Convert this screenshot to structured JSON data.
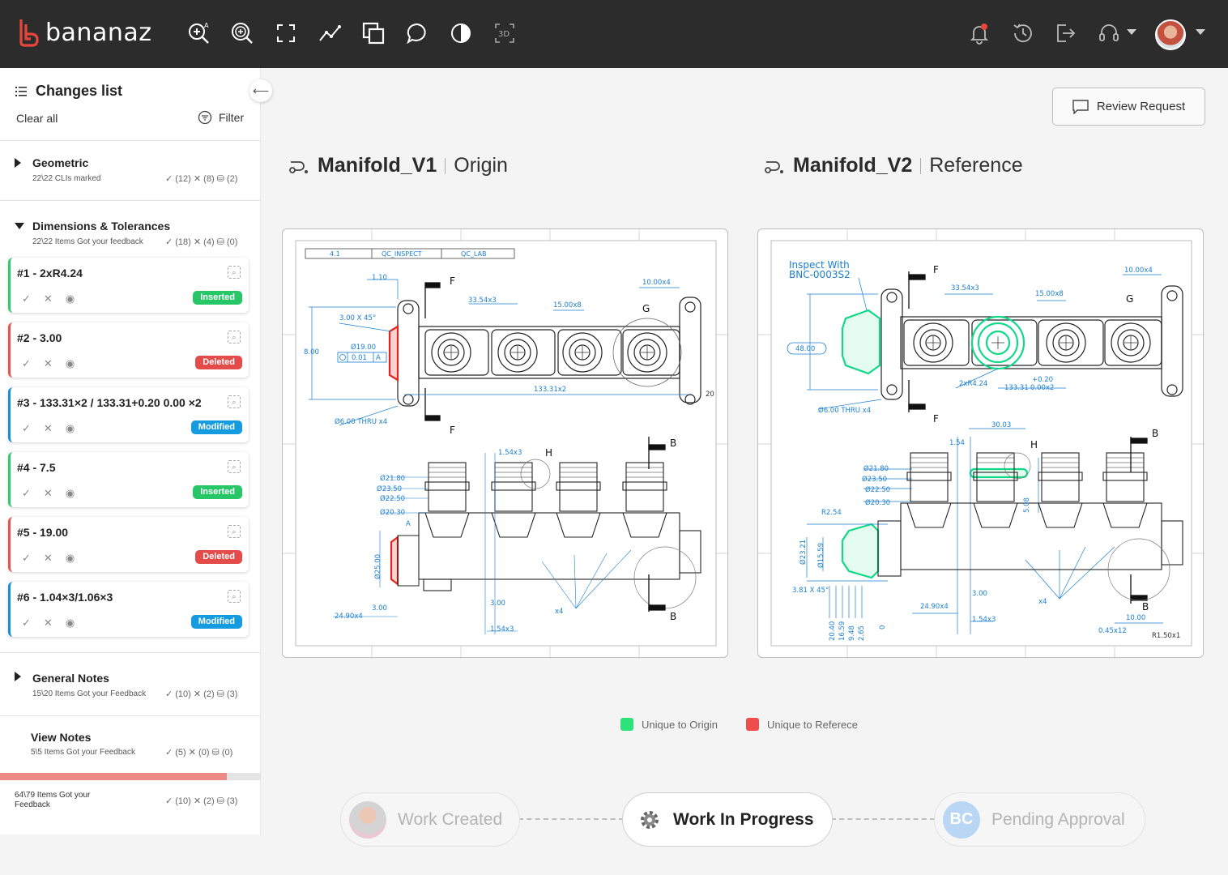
{
  "app": {
    "logo_text": "bananaz"
  },
  "toolbar": {
    "tools": [
      "zoom-text-icon",
      "zoom-in-icon",
      "fit-screen-icon",
      "line-graph-icon",
      "overlay-icon",
      "comment-icon",
      "contrast-icon",
      "3d-view-icon"
    ],
    "right": [
      "bell-icon",
      "history-icon",
      "logout-icon",
      "support-headset-icon"
    ]
  },
  "sidebar": {
    "title": "Changes list",
    "clear_all": "Clear all",
    "filter": "Filter",
    "groups": [
      {
        "title": "Geometric",
        "sub": "22\\22 CLIs marked",
        "stats": "✓ (12)  ✕ (8)  ⛁ (2)"
      },
      {
        "title": "Dimensions & Tolerances",
        "sub": "22\\22 Items Got your feedback",
        "stats": "✓ (18)  ✕ (4)  ⛁ (0)"
      },
      {
        "title": "General Notes",
        "sub": "15\\20 Items Got your Feedback",
        "stats": "✓ (10)  ✕ (2)  ⛁ (3)"
      },
      {
        "title": "View Notes",
        "sub": "5\\5 Items Got your Feedback",
        "stats": "✓ (5)  ✕ (0)  ⛁ (0)"
      }
    ],
    "cards": [
      {
        "title": "#1 - 2xR4.24",
        "status": "Inserted"
      },
      {
        "title": "#2 - 3.00",
        "status": "Deleted"
      },
      {
        "title": "#3 - 133.31×2 / 133.31+0.20 0.00 ×2",
        "status": "Modified"
      },
      {
        "title": "#4 - 7.5",
        "status": "Inserted"
      },
      {
        "title": "#5 - 19.00",
        "status": "Deleted"
      },
      {
        "title": "#6 - 1.04×3/1.06×3",
        "status": "Modified"
      }
    ],
    "card_actions": {
      "accept": "✓",
      "reject": "✕",
      "view": "◉"
    },
    "footer": {
      "text": "64\\79 Items Got your Feedback",
      "stats": "✓ (10)  ✕ (2)  ⛁ (3)",
      "progress": 0.87
    }
  },
  "main": {
    "review_button": "Review Request",
    "left": {
      "name": "Manifold_V1",
      "role": "Origin"
    },
    "right": {
      "name": "Manifold_V2",
      "role": "Reference"
    },
    "drawing_left": {
      "header_cells": [
        "4.1",
        "QC_INSPECT",
        "QC_LAB"
      ],
      "labels": [
        "1.10",
        "F",
        "33.54x3",
        "15.00x8",
        "10.00x4",
        "G",
        "3.00 X 45°",
        "8.00",
        "Ø19.00",
        "0.01",
        "A",
        "133.31x2",
        "20",
        "Ø6.00 THRU x4",
        "F",
        "1.54x3",
        "H",
        "B",
        "Ø21.80",
        "Ø23.50",
        "Ø22.50",
        "Ø20.30",
        "A",
        "Ø25.00",
        "3.00",
        "24.90x4",
        "3.00",
        "1.54x3",
        "x4",
        "B"
      ]
    },
    "drawing_right": {
      "labels": [
        "Inspect With",
        "BNC-0003S2",
        "F",
        "33.54x3",
        "15.00x8",
        "10.00x4",
        "G",
        "48.00",
        "2xR4.24",
        "+0.20",
        "133.31",
        "0.00x2",
        "Ø6.00 THRU x4",
        "F",
        "30.03",
        "1.54",
        "H",
        "B",
        "Ø21.80",
        "Ø23.50",
        "Ø22.50",
        "Ø20.30",
        "5.08",
        "R2.54",
        "Ø23.21",
        "Ø15.59",
        "3.81 X 45°",
        "24.90x4",
        "3.00",
        "x4",
        "B",
        "1.54x3",
        "10.00",
        "0.45x12",
        "R1.50x1",
        "20.40",
        "16.59",
        "9.48",
        "2.65",
        "0"
      ]
    },
    "legend": [
      {
        "label": "Unique to Origin",
        "color": "#2ee27a"
      },
      {
        "label": "Unique to Referece",
        "color": "#ef4d4d"
      }
    ]
  },
  "workflow": {
    "steps": [
      {
        "label": "Work Created",
        "state": "done"
      },
      {
        "label": "Work In Progress",
        "state": "active"
      },
      {
        "label": "Pending Approval",
        "state": "pending",
        "initials": "BC"
      }
    ]
  },
  "colors": {
    "accent_green": "#27c768",
    "accent_red": "#e44b4b",
    "accent_blue": "#159be0",
    "dimension_blue": "#1a7fd0",
    "topbar": "#2c2c2c"
  }
}
